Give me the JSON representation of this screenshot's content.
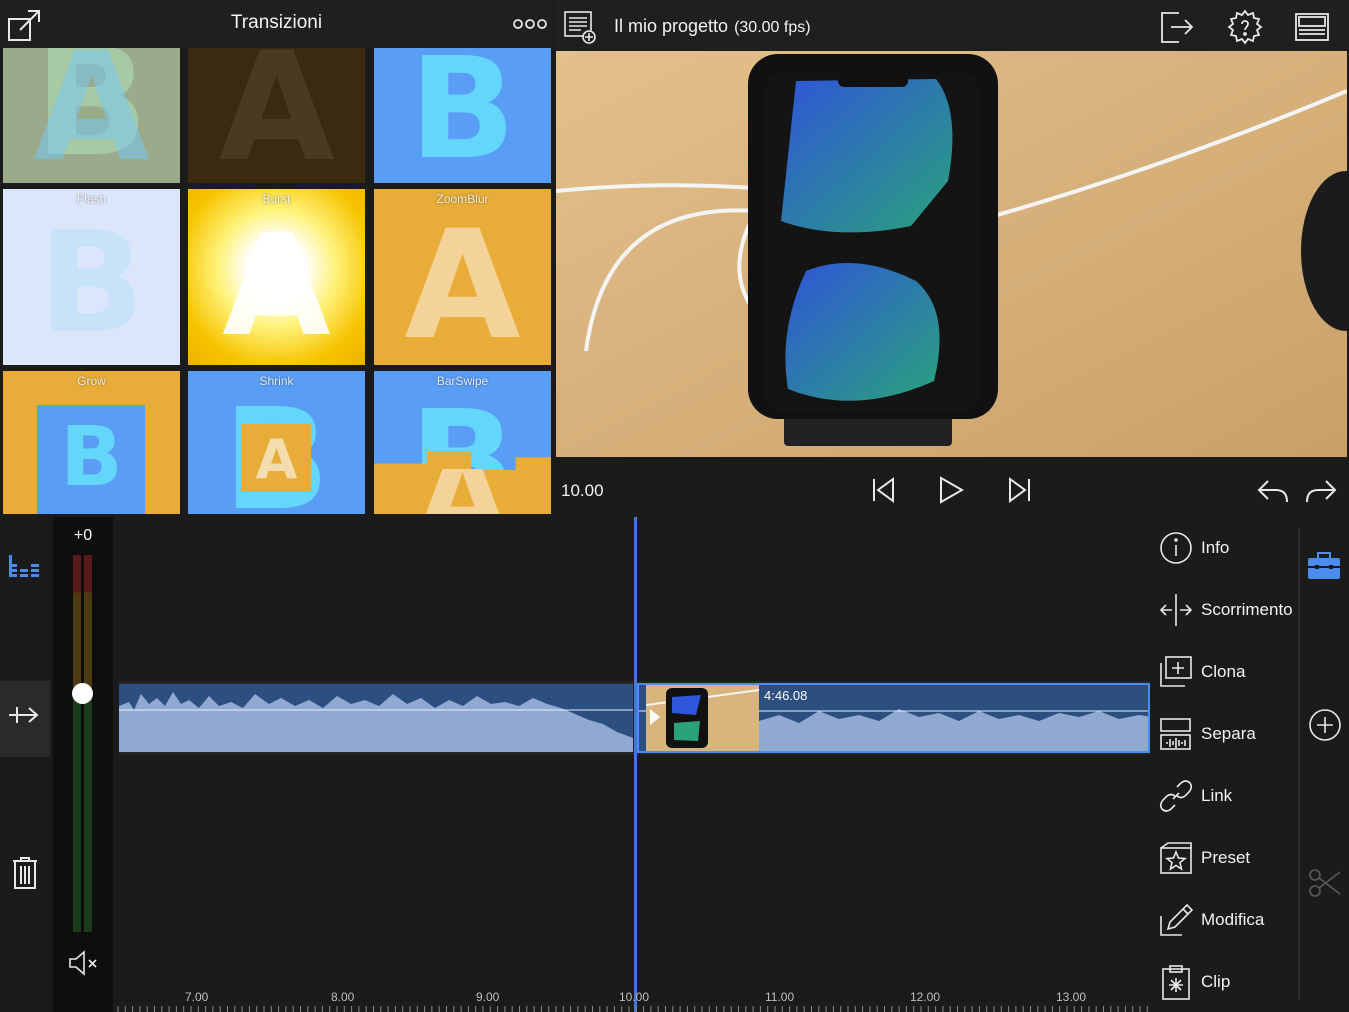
{
  "transitions": {
    "title": "Transizioni",
    "tiles": [
      {
        "label": "",
        "letter": "B",
        "bg": "#9aab8c"
      },
      {
        "label": "",
        "letter": "A",
        "bg": "#3a2a10"
      },
      {
        "label": "",
        "letter": "B",
        "bg": "#5a9df5"
      },
      {
        "label": "Flash",
        "letter": "B",
        "bg": "#dce6fb"
      },
      {
        "label": "Burst",
        "letter": "A",
        "bg": "#f3d000"
      },
      {
        "label": "ZoomBlur",
        "letter": "A",
        "bg": "#e8ad38"
      },
      {
        "label": "Grow",
        "letter": "B",
        "bg": "#e8ad38"
      },
      {
        "label": "Shrink",
        "letter": "A",
        "bg": "#5a9df5"
      },
      {
        "label": "BarSwipe",
        "letter": "A",
        "bg": "#5a9df5"
      }
    ]
  },
  "preview": {
    "project_name": "Il mio progetto",
    "fps": "(30.00 fps)",
    "timecode": "10.00"
  },
  "timeline": {
    "volume": "+0",
    "volume_level": 0.5,
    "clip_duration": "4:46.08",
    "ruler": [
      "7.00",
      "8.00",
      "9.00",
      "10.00",
      "11.00",
      "12.00",
      "13.00"
    ]
  },
  "menu": {
    "items": [
      {
        "label": "Info",
        "icon": "info-icon"
      },
      {
        "label": "Scorrimento",
        "icon": "slide-icon"
      },
      {
        "label": "Clona",
        "icon": "clone-icon"
      },
      {
        "label": "Separa",
        "icon": "split-audio-icon"
      },
      {
        "label": "Link",
        "icon": "link-icon"
      },
      {
        "label": "Preset",
        "icon": "preset-star-icon"
      },
      {
        "label": "Modifica",
        "icon": "pencil-icon"
      },
      {
        "label": "Clip",
        "icon": "clipboard-icon"
      }
    ]
  },
  "colors": {
    "accent": "#4a8cf0",
    "clip_blue": "#2c4f80",
    "waveform": "#8fa9d0"
  }
}
